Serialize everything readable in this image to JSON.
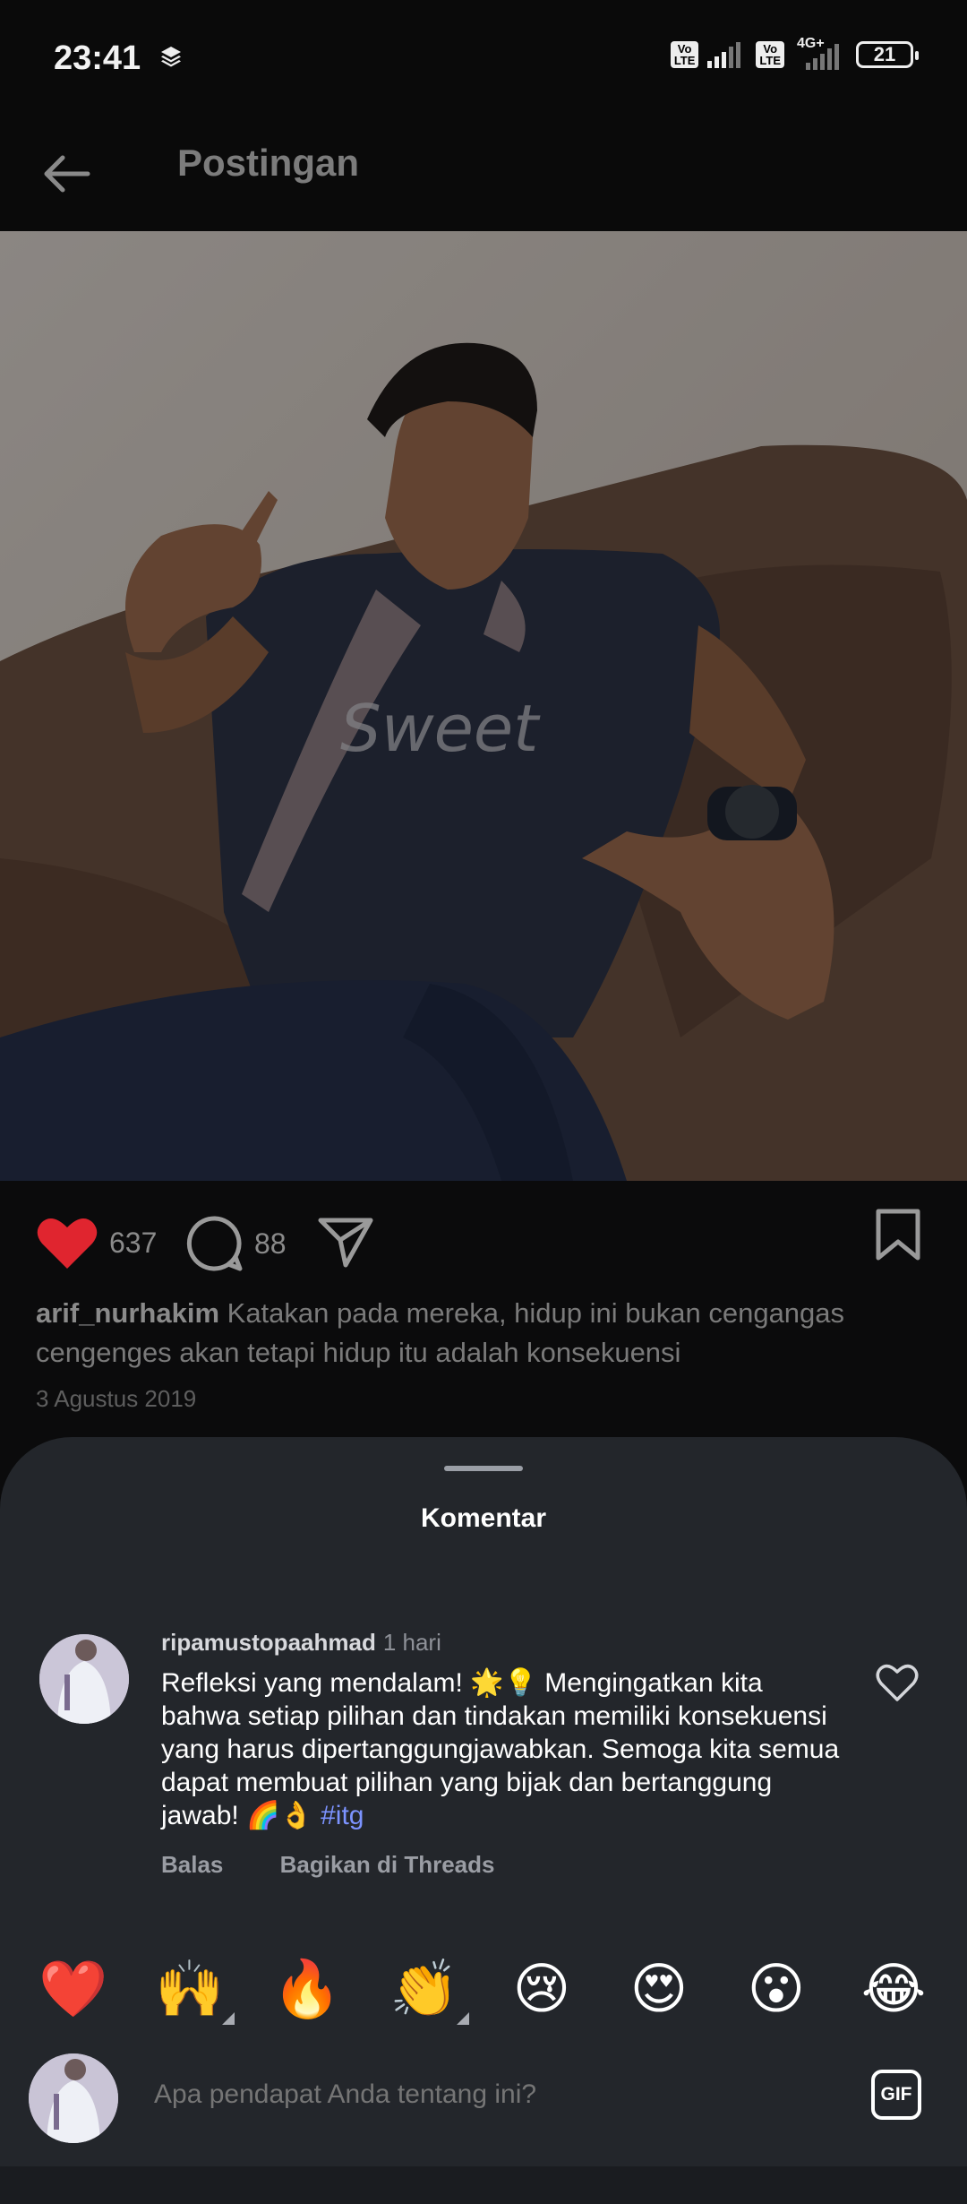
{
  "status_bar": {
    "time": "23:41",
    "volte_label_1": "Vo\nLTE",
    "volte_label_2": "Vo\nLTE",
    "network": "4G+",
    "battery": "21"
  },
  "header": {
    "title": "Postingan",
    "back_icon": "arrow-left-icon"
  },
  "post": {
    "likes": "637",
    "comments": "88",
    "author": "arif_nurhakim",
    "caption": "Katakan pada mereka, hidup ini bukan cengangas cengenges akan tetapi hidup itu adalah konsekuensi",
    "date": "3 Agustus 2019"
  },
  "comments_sheet": {
    "title": "Komentar",
    "comment": {
      "user": "ripamustopaahmad",
      "time": "1 hari",
      "text": "Refleksi yang mendalam! 🌟💡 Mengingatkan kita bahwa setiap pilihan dan tindakan memiliki konsekuensi yang harus dipertanggungjawabkan. Semoga kita semua dapat membuat pilihan yang bijak dan bertanggung jawab! 🌈👌",
      "hashtag": "#itg",
      "reply_label": "Balas",
      "share_label": "Bagikan di Threads"
    },
    "emojis": [
      "❤️",
      "🙌",
      "🔥",
      "👏",
      "😢",
      "😍",
      "😮",
      "😂"
    ],
    "composer": {
      "placeholder": "Apa pendapat Anda tentang ini?",
      "gif_label": "GIF"
    }
  },
  "colors": {
    "like_red": "#e0252f",
    "hashtag": "#7c93ff",
    "sheet_bg": "#23262b"
  }
}
